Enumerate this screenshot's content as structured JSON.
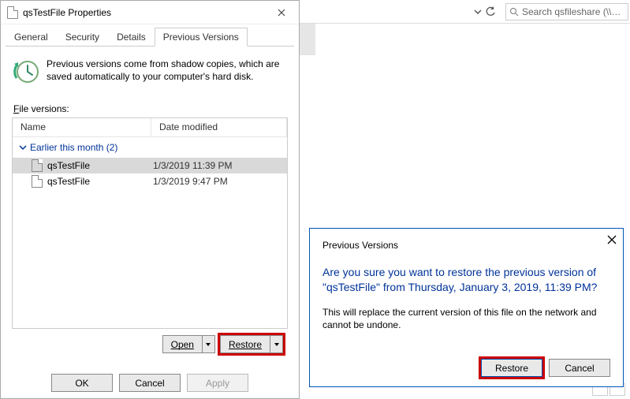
{
  "explorer": {
    "search_placeholder": "Search qsfileshare (\\\\qsstorag..."
  },
  "props": {
    "title": "qsTestFile Properties",
    "tabs": {
      "general": "General",
      "security": "Security",
      "details": "Details",
      "previous": "Previous Versions"
    },
    "info": "Previous versions come from shadow copies, which are saved automatically to your computer's hard disk.",
    "file_versions_label_pre": "F",
    "file_versions_label_post": "ile versions:",
    "columns": {
      "name": "Name",
      "date": "Date modified"
    },
    "group": "Earlier this month (2)",
    "rows": [
      {
        "name": "qsTestFile",
        "date": "1/3/2019 11:39 PM",
        "selected": true
      },
      {
        "name": "qsTestFile",
        "date": "1/3/2019 9:47 PM",
        "selected": false
      }
    ],
    "open": "Open",
    "restore": "Restore",
    "ok": "OK",
    "cancel": "Cancel",
    "apply": "Apply"
  },
  "confirm": {
    "title": "Previous Versions",
    "main": "Are you sure you want to restore the previous version of \"qsTestFile\" from Thursday, January 3, 2019, 11:39 PM?",
    "sub": "This will replace the current version of this file on the network and cannot be undone.",
    "restore": "Restore",
    "cancel": "Cancel"
  }
}
